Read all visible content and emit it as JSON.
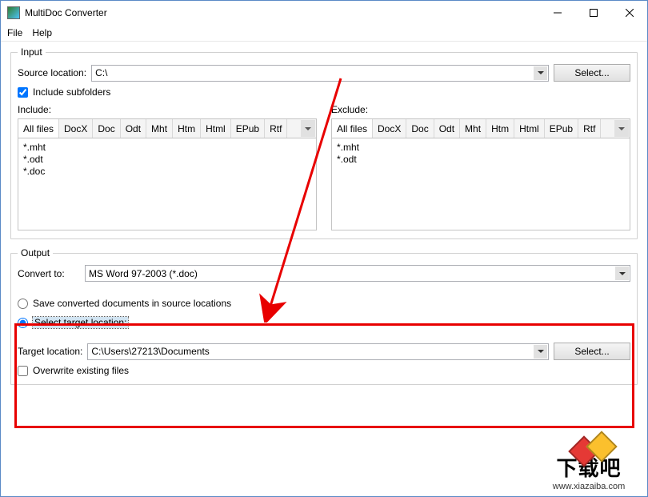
{
  "window": {
    "title": "MultiDoc Converter"
  },
  "menu": {
    "file": "File",
    "help": "Help"
  },
  "input": {
    "legend": "Input",
    "source_label": "Source location:",
    "source_value": "C:\\",
    "select_btn": "Select...",
    "include_sub_label": "Include subfolders",
    "include_checked": true,
    "include_label": "Include:",
    "exclude_label": "Exclude:",
    "tabs": {
      "all": "All files",
      "docx": "DocX",
      "doc": "Doc",
      "odt": "Odt",
      "mht": "Mht",
      "htm": "Htm",
      "html": "Html",
      "epub": "EPub",
      "rtf": "Rtf"
    },
    "include_list": [
      "*.mht",
      "*.odt",
      "*.doc"
    ],
    "exclude_list": [
      "*.mht",
      "*.odt"
    ]
  },
  "output": {
    "legend": "Output",
    "convert_label": "Convert to:",
    "convert_value": "MS Word 97-2003 (*.doc)",
    "opt1": "Save converted documents in source locations",
    "opt2": "Select target location:",
    "target_label": "Target location:",
    "target_value": "C:\\Users\\27213\\Documents",
    "select_btn": "Select...",
    "overwrite_label": "Overwrite existing files"
  },
  "watermark": {
    "text": "下载吧",
    "url": "www.xiazaiba.com"
  }
}
